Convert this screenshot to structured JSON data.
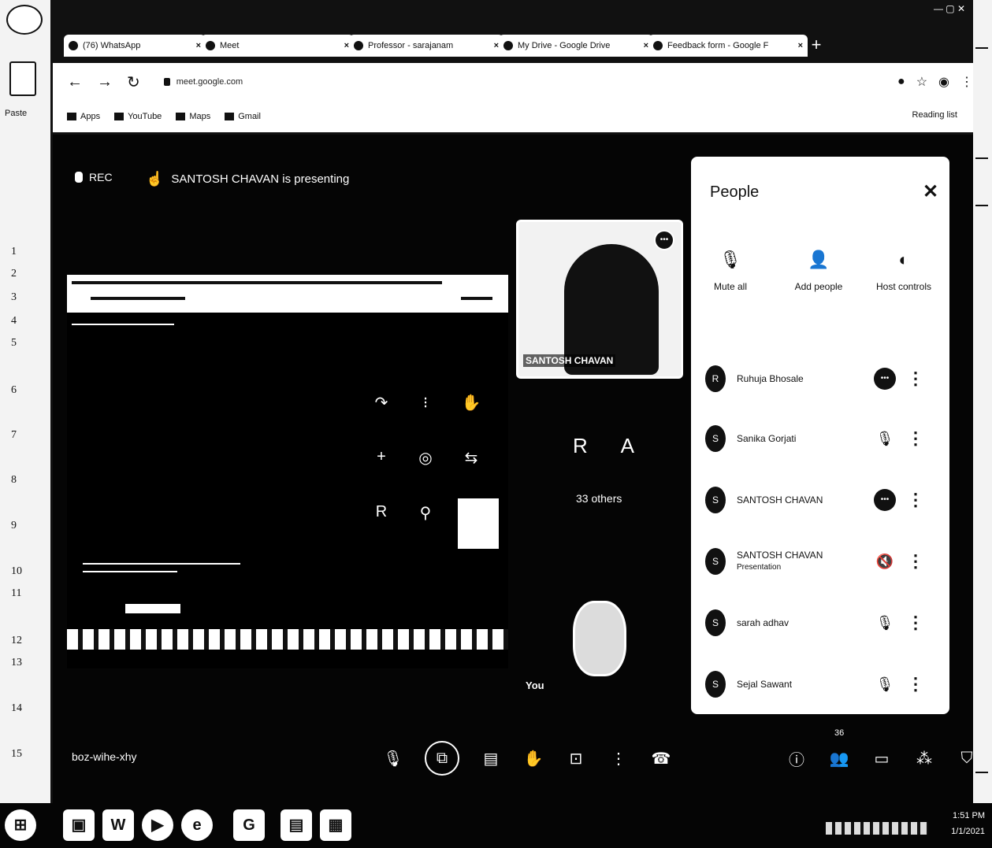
{
  "word": {
    "paste_label": "Paste",
    "line_numbers": [
      "1",
      "2",
      "3",
      "4",
      "5",
      "6",
      "7",
      "8",
      "9",
      "10",
      "11",
      "12",
      "13",
      "14",
      "15"
    ]
  },
  "browser": {
    "tabs": [
      {
        "title": "(76) WhatsApp"
      },
      {
        "title": "Meet"
      },
      {
        "title": "Professor - sarajanam"
      },
      {
        "title": "My Drive - Google Drive"
      },
      {
        "title": "Feedback form - Google F"
      }
    ],
    "url": "meet.google.com",
    "bookmarks": [
      "Apps",
      "YouTube",
      "Maps",
      "Gmail"
    ],
    "reading_list": "Reading list"
  },
  "meet": {
    "rec_label": "REC",
    "presenting_text": "SANTOSH CHAVAN is presenting",
    "presenter_name": "SANTOSH CHAVAN",
    "others_initials": "R A",
    "others_count": "33 others",
    "self_label": "You",
    "meeting_code": "boz-wihe-xhy",
    "people_count": "36",
    "icons": {
      "mic": "microphone-icon",
      "present": "present-screen-icon",
      "captions": "captions-icon",
      "raise_hand": "raise-hand-icon",
      "present_now": "present-now-icon",
      "more": "more-options-icon",
      "leave": "leave-call-icon",
      "info": "meeting-details-icon",
      "people": "people-icon",
      "chat": "chat-icon",
      "activities": "activities-icon",
      "host": "host-controls-icon"
    }
  },
  "people_panel": {
    "title": "People",
    "actions": [
      "Mute all",
      "Add people",
      "Host controls"
    ],
    "participants": [
      {
        "initial": "R",
        "name": "Ruhuja Bhosale",
        "sub": "",
        "status": "speaking"
      },
      {
        "initial": "S",
        "name": "Sanika Gorjati",
        "sub": "",
        "status": "muted"
      },
      {
        "initial": "S",
        "name": "SANTOSH CHAVAN",
        "sub": "",
        "status": "speaking"
      },
      {
        "initial": "S",
        "name": "SANTOSH CHAVAN",
        "sub": "Presentation",
        "status": "muted"
      },
      {
        "initial": "S",
        "name": "sarah adhav",
        "sub": "",
        "status": "muted"
      },
      {
        "initial": "S",
        "name": "Sejal Sawant",
        "sub": "",
        "status": "muted"
      }
    ]
  },
  "taskbar": {
    "time": "1:51 PM",
    "date": "1/1/2021"
  }
}
